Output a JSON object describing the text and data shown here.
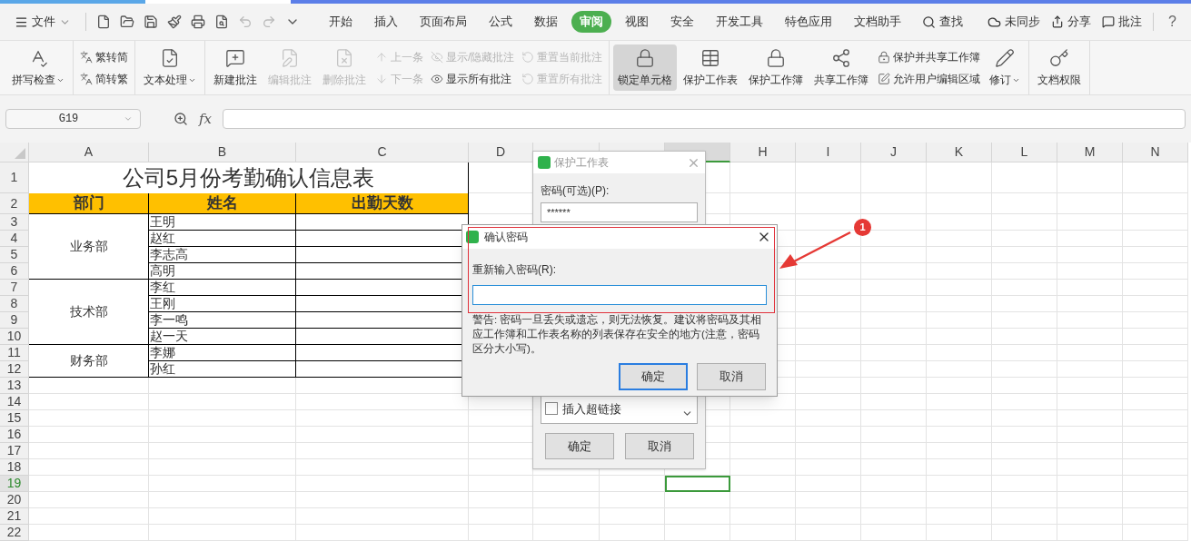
{
  "menubar": {
    "file_menu": "文件",
    "tabs": [
      {
        "label": "开始",
        "selected": false
      },
      {
        "label": "插入",
        "selected": false
      },
      {
        "label": "页面布局",
        "selected": false
      },
      {
        "label": "公式",
        "selected": false
      },
      {
        "label": "数据",
        "selected": false
      },
      {
        "label": "审阅",
        "selected": true
      },
      {
        "label": "视图",
        "selected": false
      },
      {
        "label": "安全",
        "selected": false
      },
      {
        "label": "开发工具",
        "selected": false
      },
      {
        "label": "特色应用",
        "selected": false
      },
      {
        "label": "文档助手",
        "selected": false
      }
    ],
    "search": "查找",
    "sync": "未同步",
    "share": "分享",
    "comment": "批注",
    "help": "?"
  },
  "ribbon": {
    "sections": [
      {
        "columns": [
          {
            "kind": "large",
            "items": [
              {
                "label": "拼写检查",
                "disabled": false,
                "dropdown": true,
                "pressed": false
              }
            ]
          }
        ]
      },
      {
        "columns": [
          {
            "kind": "stack",
            "items": [
              {
                "label": "繁转简",
                "disabled": false,
                "dropdown": false,
                "pressed": false
              },
              {
                "label": "简转繁",
                "disabled": false,
                "dropdown": false,
                "pressed": false
              }
            ]
          }
        ]
      },
      {
        "columns": [
          {
            "kind": "large",
            "items": [
              {
                "label": "文本处理",
                "disabled": false,
                "dropdown": true,
                "pressed": false
              }
            ]
          }
        ]
      },
      {
        "columns": [
          {
            "kind": "large",
            "items": [
              {
                "label": "新建批注",
                "disabled": false,
                "dropdown": false,
                "pressed": false
              }
            ]
          },
          {
            "kind": "large",
            "items": [
              {
                "label": "编辑批注",
                "disabled": true,
                "dropdown": false,
                "pressed": false
              }
            ]
          },
          {
            "kind": "large",
            "items": [
              {
                "label": "删除批注",
                "disabled": true,
                "dropdown": false,
                "pressed": false
              }
            ]
          },
          {
            "kind": "stack",
            "items": [
              {
                "label": "上一条",
                "disabled": true,
                "dropdown": false,
                "pressed": false
              },
              {
                "label": "下一条",
                "disabled": true,
                "dropdown": false,
                "pressed": false
              }
            ]
          },
          {
            "kind": "stack",
            "items": [
              {
                "label": "显示/隐藏批注",
                "disabled": true,
                "dropdown": false,
                "pressed": false
              },
              {
                "label": "显示所有批注",
                "disabled": false,
                "dropdown": false,
                "pressed": false
              }
            ]
          },
          {
            "kind": "stack",
            "items": [
              {
                "label": "重置当前批注",
                "disabled": true,
                "dropdown": false,
                "pressed": false
              },
              {
                "label": "重置所有批注",
                "disabled": true,
                "dropdown": false,
                "pressed": false
              }
            ]
          }
        ]
      },
      {
        "columns": [
          {
            "kind": "large",
            "items": [
              {
                "label": "锁定单元格",
                "disabled": false,
                "dropdown": false,
                "pressed": true
              }
            ]
          },
          {
            "kind": "large",
            "items": [
              {
                "label": "保护工作表",
                "disabled": false,
                "dropdown": false,
                "pressed": false
              }
            ]
          },
          {
            "kind": "large",
            "items": [
              {
                "label": "保护工作簿",
                "disabled": false,
                "dropdown": false,
                "pressed": false
              }
            ]
          },
          {
            "kind": "large",
            "items": [
              {
                "label": "共享工作簿",
                "disabled": false,
                "dropdown": false,
                "pressed": false
              }
            ]
          },
          {
            "kind": "stack",
            "items": [
              {
                "label": "保护并共享工作簿",
                "disabled": false,
                "dropdown": false,
                "pressed": false
              },
              {
                "label": "允许用户编辑区域",
                "disabled": false,
                "dropdown": false,
                "pressed": false
              }
            ]
          },
          {
            "kind": "large",
            "items": [
              {
                "label": "修订",
                "disabled": false,
                "dropdown": true,
                "pressed": false
              }
            ]
          }
        ]
      },
      {
        "columns": [
          {
            "kind": "large",
            "items": [
              {
                "label": "文档权限",
                "disabled": false,
                "dropdown": false,
                "pressed": false
              }
            ]
          }
        ]
      }
    ]
  },
  "formula_bar": {
    "name_box": "G19",
    "fx": "fx"
  },
  "sheet": {
    "columns": [
      {
        "label": "A",
        "selected": false
      },
      {
        "label": "B",
        "selected": false
      },
      {
        "label": "C",
        "selected": false
      },
      {
        "label": "D",
        "selected": false
      },
      {
        "selected": false
      },
      {
        "selected": false
      },
      {
        "selected": true
      },
      {
        "label": "H",
        "selected": false
      },
      {
        "label": "I",
        "selected": false
      },
      {
        "label": "J",
        "selected": false
      },
      {
        "label": "K",
        "selected": false
      },
      {
        "label": "L",
        "selected": false
      },
      {
        "label": "M",
        "selected": false
      },
      {
        "label": "N",
        "selected": false
      }
    ],
    "rows": [
      {
        "label": "1",
        "selected": false
      },
      {
        "label": "2",
        "selected": false
      },
      {
        "label": "3",
        "selected": false
      },
      {
        "label": "4",
        "selected": false
      },
      {
        "label": "5",
        "selected": false
      },
      {
        "label": "6",
        "selected": false
      },
      {
        "label": "7",
        "selected": false
      },
      {
        "label": "8",
        "selected": false
      },
      {
        "label": "9",
        "selected": false
      },
      {
        "label": "10",
        "selected": false
      },
      {
        "label": "11",
        "selected": false
      },
      {
        "label": "12",
        "selected": false
      },
      {
        "label": "13",
        "selected": false
      },
      {
        "label": "14",
        "selected": false
      },
      {
        "label": "15",
        "selected": false
      },
      {
        "label": "16",
        "selected": false
      },
      {
        "label": "17",
        "selected": false
      },
      {
        "label": "18",
        "selected": false
      },
      {
        "label": "19",
        "selected": true
      },
      {
        "label": "20",
        "selected": false
      },
      {
        "label": "21",
        "selected": false
      },
      {
        "label": "22",
        "selected": false
      }
    ],
    "table": {
      "title": "公司5月份考勤确认信息表",
      "headers": [
        "部门",
        "姓名",
        "出勤天数"
      ],
      "departments": [
        {
          "name": "业务部",
          "members": [
            "王明",
            "赵红",
            "李志高",
            "高明"
          ]
        },
        {
          "name": "技术部",
          "members": [
            "李红",
            "王刚",
            "李一鸣",
            "赵一天"
          ]
        },
        {
          "name": "财务部",
          "members": [
            "李娜",
            "孙红"
          ]
        }
      ]
    }
  },
  "protect_dialog": {
    "title": "保护工作表",
    "password_label": "密码(可选)(P):",
    "password_value": "******",
    "options": [
      {
        "label": "插入超链接",
        "checked": false
      }
    ],
    "buttons": [
      "确定",
      "取消"
    ]
  },
  "confirm_dialog": {
    "title": "确认密码",
    "label": "重新输入密码(R):",
    "warning": "警告: 密码一旦丢失或遗忘，则无法恢复。建议将密码及其相应工作簿和工作表名称的列表保存在安全的地方(注意，密码区分大小写)。",
    "buttons": [
      {
        "label": "确定",
        "default": true
      },
      {
        "label": "取消",
        "default": false
      }
    ]
  },
  "annotation": {
    "badge": "1"
  }
}
